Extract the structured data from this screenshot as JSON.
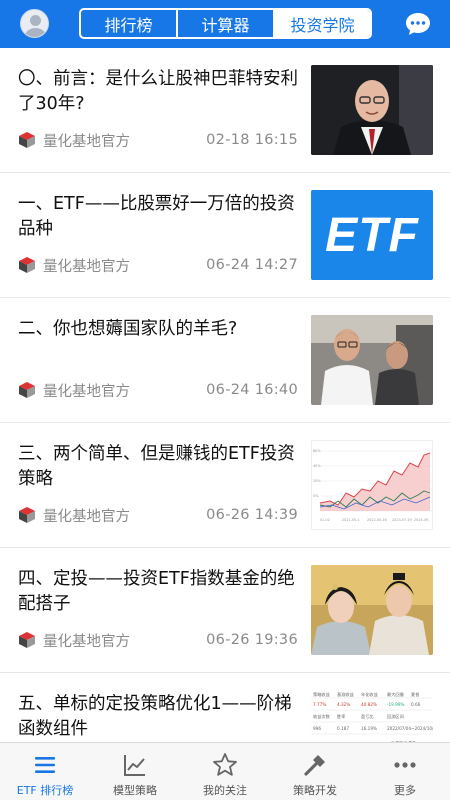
{
  "header": {
    "tabs": [
      {
        "label": "排行榜",
        "active": false
      },
      {
        "label": "计算器",
        "active": false
      },
      {
        "label": "投资学院",
        "active": true
      }
    ],
    "accent_color": "#1877e6"
  },
  "articles": [
    {
      "title": "〇、前言：是什么让股神巴菲特安利了30年?",
      "author": "量化基地官方",
      "time": "02-18 16:15",
      "thumb": "portrait-photo"
    },
    {
      "title": "一、ETF——比股票好一万倍的投资品种",
      "author": "量化基地官方",
      "time": "06-24 14:27",
      "thumb": "etf-logo",
      "thumb_text": "ETF"
    },
    {
      "title": "二、你也想薅国家队的羊毛?",
      "author": "量化基地官方",
      "time": "06-24 16:40",
      "thumb": "people-photo"
    },
    {
      "title": "三、两个简单、但是赚钱的ETF投资策略",
      "author": "量化基地官方",
      "time": "06-26 14:39",
      "thumb": "line-chart"
    },
    {
      "title": "四、定投——投资ETF指数基金的绝配搭子",
      "author": "量化基地官方",
      "time": "06-26 19:36",
      "thumb": "drama-photo"
    },
    {
      "title": "五、单标的定投策略优化1——阶梯函数组件",
      "author": "",
      "time": "",
      "thumb": "data-table"
    }
  ],
  "tabbar": [
    {
      "label": "ETF 排行榜",
      "icon": "list-icon",
      "active": true
    },
    {
      "label": "模型策略",
      "icon": "trend-chart-icon",
      "active": false
    },
    {
      "label": "我的关注",
      "icon": "star-icon",
      "active": false
    },
    {
      "label": "策略开发",
      "icon": "hammer-icon",
      "active": false
    },
    {
      "label": "更多",
      "icon": "more-dots-icon",
      "active": false
    }
  ]
}
